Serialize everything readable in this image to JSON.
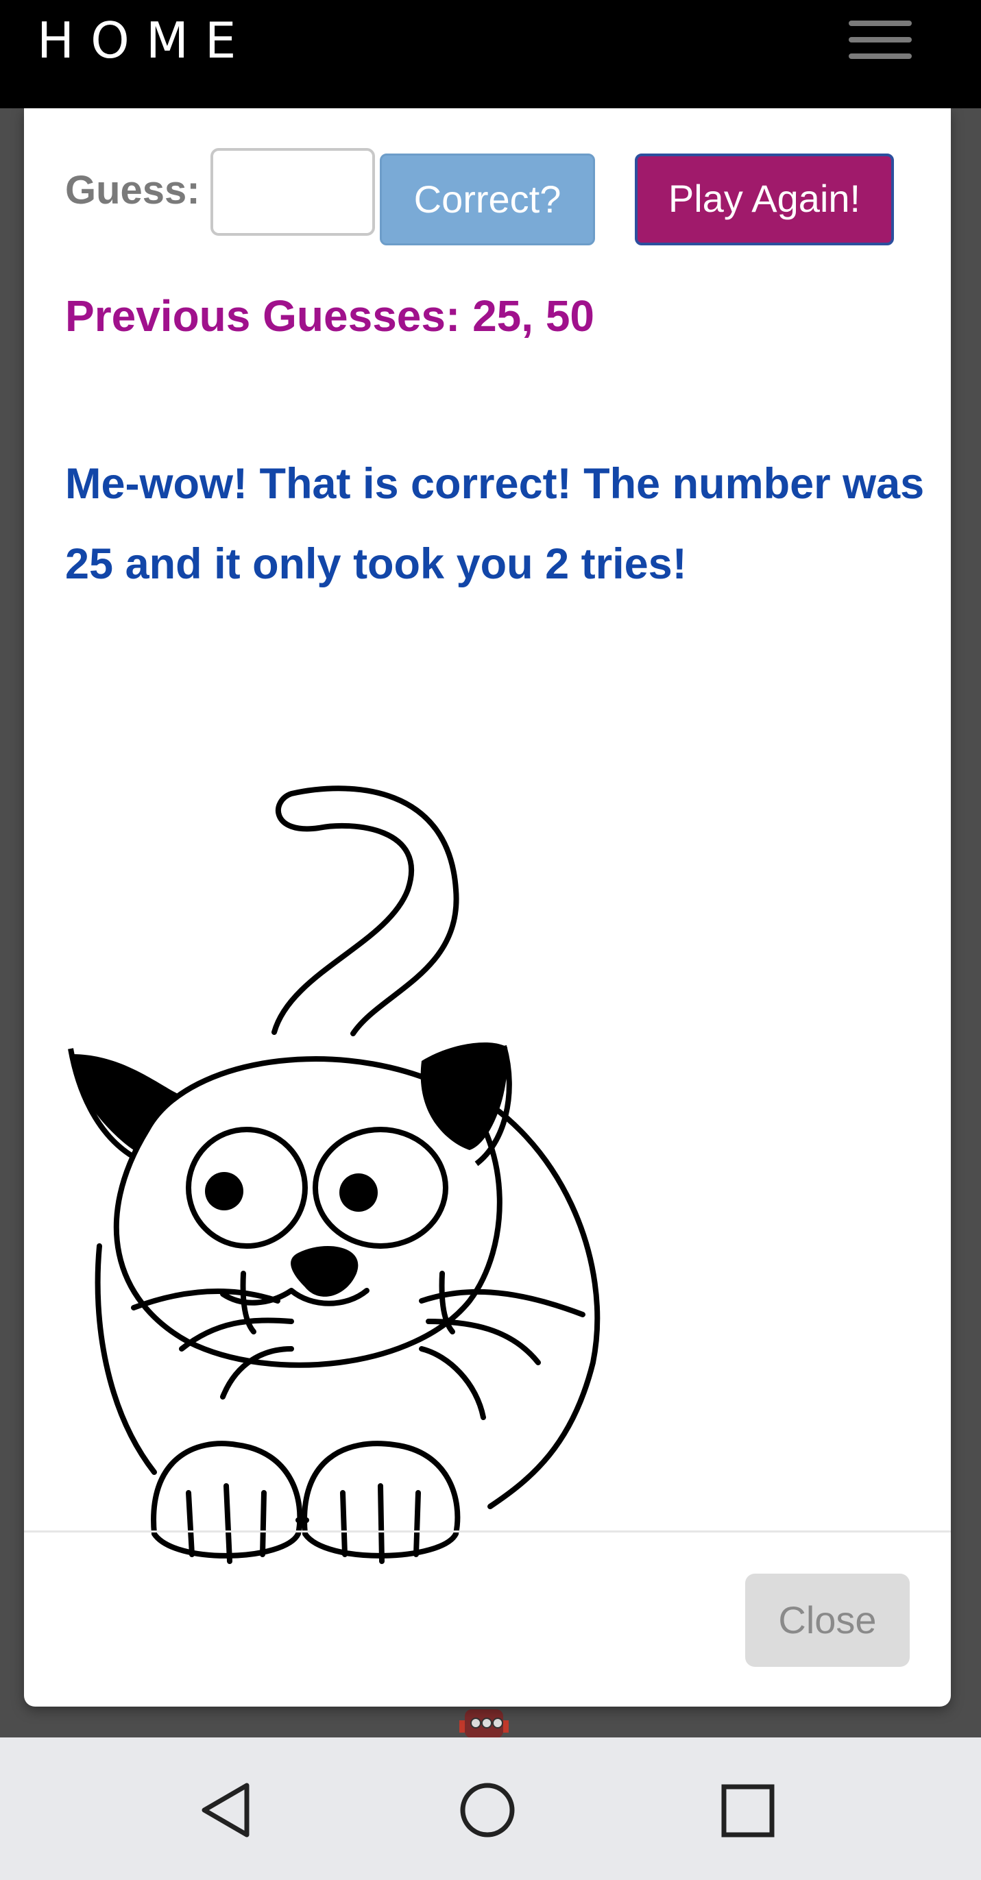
{
  "navbar": {
    "brand": "HOME",
    "menu_icon": "hamburger-menu-icon"
  },
  "modal": {
    "guess_label": "Guess:",
    "guess_value": "",
    "correct_button": "Correct?",
    "play_again_button": "Play Again!",
    "previous_guesses": "Previous Guesses: 25, 50",
    "result_message": "Me-wow! That is correct! The number was 25 and it only took you 2 tries!",
    "close_button": "Close",
    "image_icon": "cartoon-cat-icon"
  },
  "android_nav": {
    "back_icon": "back-triangle-icon",
    "home_icon": "home-circle-icon",
    "recents_icon": "recents-square-icon"
  },
  "colors": {
    "navbar_bg": "#000000",
    "correct_button_bg": "#7aaad6",
    "play_again_bg": "#a01a6b",
    "previous_guesses_text": "#a0118c",
    "result_text": "#1246a8",
    "close_button_bg": "#dcdcdc"
  }
}
